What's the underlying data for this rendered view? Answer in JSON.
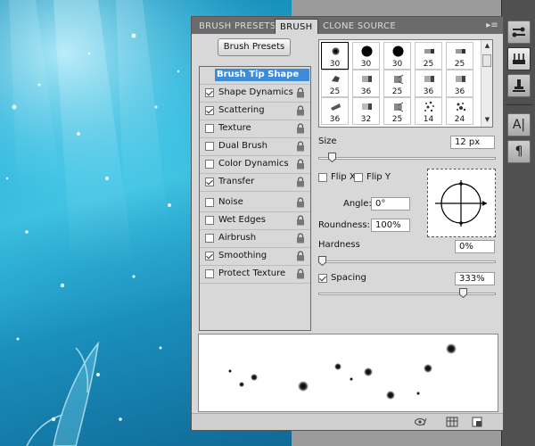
{
  "panel": {
    "tabs": [
      {
        "label": "BRUSH PRESETS"
      },
      {
        "label": "BRUSH"
      },
      {
        "label": "CLONE SOURCE"
      }
    ],
    "presets_button": "Brush Presets",
    "tip_shape_label": "Brush Tip Shape",
    "options": [
      {
        "label": "Shape Dynamics",
        "checked": true
      },
      {
        "label": "Scattering",
        "checked": true
      },
      {
        "label": "Texture",
        "checked": false
      },
      {
        "label": "Dual Brush",
        "checked": false
      },
      {
        "label": "Color Dynamics",
        "checked": false
      },
      {
        "label": "Transfer",
        "checked": true
      },
      {
        "label": "Noise",
        "checked": false
      },
      {
        "label": "Wet Edges",
        "checked": false
      },
      {
        "label": "Airbrush",
        "checked": false
      },
      {
        "label": "Smoothing",
        "checked": true
      },
      {
        "label": "Protect Texture",
        "checked": false
      }
    ],
    "brush_tips": [
      {
        "size": "30",
        "selected": true
      },
      {
        "size": "30",
        "selected": false
      },
      {
        "size": "30",
        "selected": false
      },
      {
        "size": "25",
        "selected": false
      },
      {
        "size": "25",
        "selected": false
      },
      {
        "size": "25",
        "selected": false
      },
      {
        "size": "36",
        "selected": false
      },
      {
        "size": "25",
        "selected": false
      },
      {
        "size": "36",
        "selected": false
      },
      {
        "size": "36",
        "selected": false
      },
      {
        "size": "36",
        "selected": false
      },
      {
        "size": "32",
        "selected": false
      },
      {
        "size": "25",
        "selected": false
      },
      {
        "size": "14",
        "selected": false
      },
      {
        "size": "24",
        "selected": false
      }
    ],
    "size_label": "Size",
    "size_value": "12 px",
    "size_level": 0.06,
    "flip_x_label": "Flip X",
    "flip_y_label": "Flip Y",
    "angle_label": "Angle:",
    "angle_value": "0°",
    "roundness_label": "Roundness:",
    "roundness_value": "100%",
    "hardness_label": "Hardness",
    "hardness_value": "0%",
    "hardness_level": 0.0,
    "spacing_label": "Spacing",
    "spacing_value": "333%",
    "spacing_checked": true,
    "spacing_level": 0.83,
    "accent_color": "#3d8cd8"
  },
  "dock": {
    "icons": [
      "tool-presets-icon",
      "brush-panel-icon",
      "clone-source-icon",
      "character-icon",
      "paragraph-icon"
    ]
  }
}
